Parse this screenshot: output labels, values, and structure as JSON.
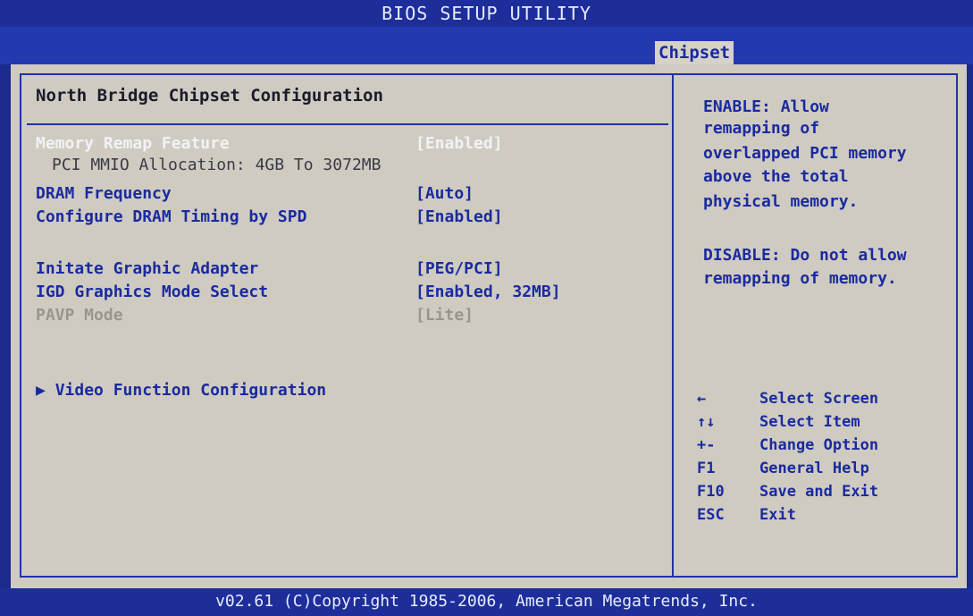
{
  "window": {
    "title": "BIOS SETUP UTILITY"
  },
  "tabs": [
    {
      "label": "Chipset",
      "active": true
    }
  ],
  "main": {
    "section_title": "North Bridge Chipset Configuration",
    "items": [
      {
        "label": "Memory Remap Feature",
        "value": "[Enabled]",
        "state": "selected"
      },
      {
        "label": "PCI MMIO Allocation: 4GB To 3072MB",
        "value": "",
        "state": "info"
      },
      {
        "label": "DRAM Frequency",
        "value": "[Auto]",
        "state": "normal"
      },
      {
        "label": "Configure DRAM Timing by SPD",
        "value": "[Enabled]",
        "state": "normal"
      },
      {
        "label": "Initate Graphic Adapter",
        "value": "[PEG/PCI]",
        "state": "normal"
      },
      {
        "label": "IGD Graphics Mode Select",
        "value": "[Enabled, 32MB]",
        "state": "normal"
      },
      {
        "label": "PAVP Mode",
        "value": "[Lite]",
        "state": "disabled"
      }
    ],
    "submenu": {
      "arrow": "▶",
      "label": "Video Function Configuration"
    }
  },
  "help": {
    "lines": [
      "ENABLE: Allow",
      "remapping of",
      "overlapped PCI memory",
      "above the total",
      "physical memory.",
      "",
      "DISABLE: Do not allow",
      "remapping of memory."
    ]
  },
  "keys": [
    {
      "key": "←",
      "desc": "Select Screen"
    },
    {
      "key": "↑↓",
      "desc": "Select Item"
    },
    {
      "key": "+-",
      "desc": "Change Option"
    },
    {
      "key": "F1",
      "desc": "General Help"
    },
    {
      "key": "F10",
      "desc": "Save and Exit"
    },
    {
      "key": "ESC",
      "desc": "Exit"
    }
  ],
  "footer": {
    "text": "v02.61 (C)Copyright 1985-2006, American Megatrends, Inc."
  },
  "colors": {
    "screen_bg": "#1b2a8c",
    "panel_bg": "#cfcbc1",
    "accent_text": "#1a2aa0",
    "selected_text": "#f2f2f6",
    "disabled_text": "#9a968e"
  }
}
